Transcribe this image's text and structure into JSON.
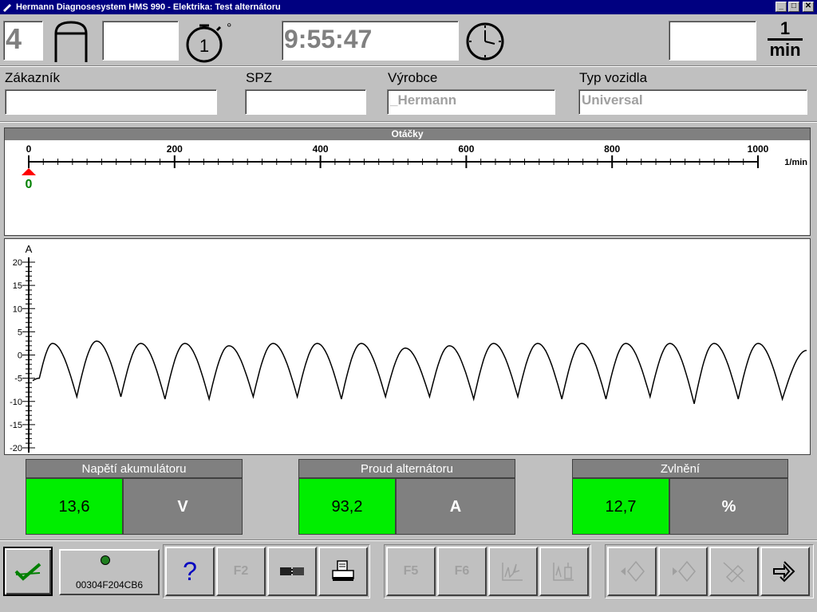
{
  "window": {
    "title": "Hermann Diagnosesystem HMS 990 - Elektrika: Test alternátoru",
    "minimize": "_",
    "maximize": "□",
    "close": "✕"
  },
  "header": {
    "cylinders": "4",
    "cylinder_icon": "cylinder-icon",
    "stopwatch_icon": "stopwatch-icon",
    "stopwatch_number": "1",
    "degree_symbol": "°",
    "time": "9:55:47",
    "clock_icon": "clock-icon",
    "rpm_unit_top": "1",
    "rpm_unit_bottom": "min"
  },
  "vehicle": {
    "customer_label": "Zákazník",
    "customer_value": "",
    "plate_label": "SPZ",
    "plate_value": "",
    "maker_label": "Výrobce",
    "maker_value": "_Hermann",
    "type_label": "Typ vozidla",
    "type_value": "Universal"
  },
  "rpm_panel": {
    "title": "Otáčky",
    "ticks": [
      "0",
      "200",
      "400",
      "600",
      "800",
      "1000"
    ],
    "unit": "1/min",
    "current_value": "0",
    "marker_color": "#ff0000",
    "value_color": "#008000"
  },
  "chart_data": {
    "type": "line",
    "ylabel": "A",
    "ylim": [
      -20,
      20
    ],
    "yticks": [
      "20",
      "15",
      "10",
      "5",
      "0",
      "-5",
      "-10",
      "-15",
      "-20"
    ],
    "series": [
      {
        "peaks": [
          2.5,
          3,
          2.5,
          2.5,
          2,
          2.5,
          2.5,
          2.5,
          1.5,
          2,
          2.5,
          2.5,
          2.5,
          2.5,
          2.5,
          2.5,
          2.5
        ],
        "troughs": [
          -5,
          -9,
          -9,
          -9.5,
          -9.5,
          -9,
          -9,
          -9.5,
          -9,
          -9,
          -9.5,
          -9,
          -9.5,
          -9.5,
          -9,
          -10.5,
          -9.5,
          -9.5
        ],
        "x_start_value": -5.5,
        "x_end_value": 1
      }
    ]
  },
  "meters": [
    {
      "title": "Napětí akumulátoru",
      "value": "13,6",
      "unit": "V"
    },
    {
      "title": "Proud alternátoru",
      "value": "93,2",
      "unit": "A"
    },
    {
      "title": "Zvlnění",
      "value": "12,7",
      "unit": "%"
    }
  ],
  "toolbar": {
    "confirm_icon": "check-icon",
    "serial": "00304F204CB6",
    "help_label": "?",
    "f2_label": "F2",
    "f5_label": "F5",
    "f6_label": "F6",
    "accent_check": "#008000",
    "accent_help": "#0000c0"
  }
}
